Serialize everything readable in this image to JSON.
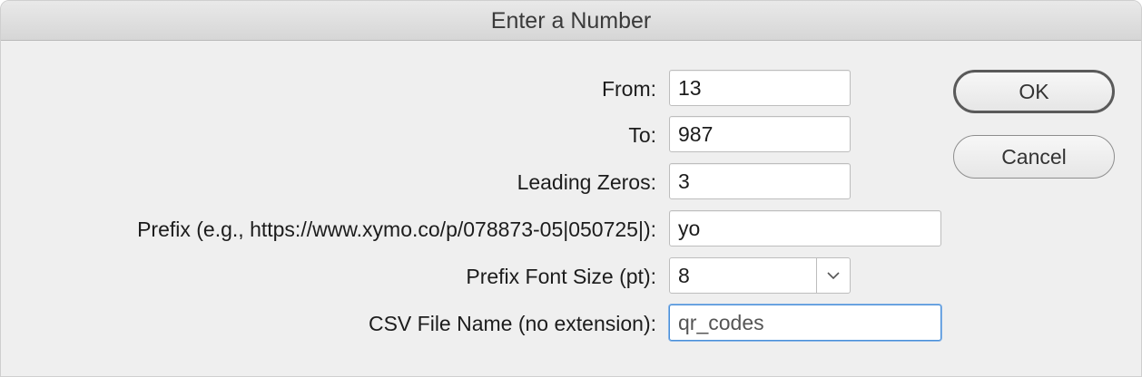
{
  "window": {
    "title": "Enter a Number"
  },
  "form": {
    "from": {
      "label": "From:",
      "value": "13"
    },
    "to": {
      "label": "To:",
      "value": "987"
    },
    "leading_zeros": {
      "label": "Leading Zeros:",
      "value": "3"
    },
    "prefix": {
      "label": "Prefix (e.g., https://www.xymo.co/p/078873-05|050725|):",
      "value": "yo"
    },
    "prefix_font_size": {
      "label": "Prefix Font Size (pt):",
      "selected": "8"
    },
    "csv_file_name": {
      "label": "CSV File Name (no extension):",
      "value": "qr_codes"
    }
  },
  "buttons": {
    "ok": "OK",
    "cancel": "Cancel"
  },
  "icons": {
    "dropdown": "chevron-down-icon"
  }
}
